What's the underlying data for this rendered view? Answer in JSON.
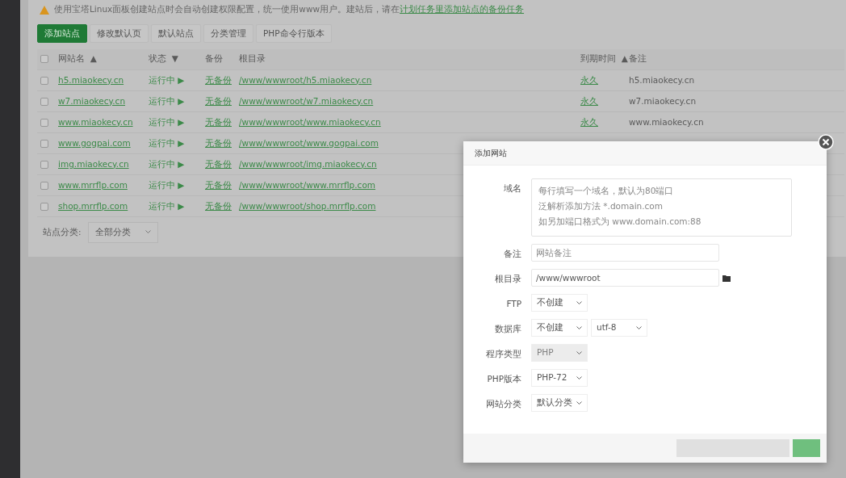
{
  "notice": {
    "text": "使用宝塔Linux面板创建站点时会自动创建权限配置，统一使用www用户。建站后，请在",
    "link": "计划任务里添加站点的备份任务"
  },
  "toolbar": [
    {
      "label": "添加站点",
      "kind": "primary"
    },
    {
      "label": "修改默认页",
      "kind": "plain"
    },
    {
      "label": "默认站点",
      "kind": "plain"
    },
    {
      "label": "分类管理",
      "kind": "plain"
    },
    {
      "label": "PHP命令行版本",
      "kind": "plain"
    }
  ],
  "table": {
    "select_all": {
      "checked": false
    },
    "columns": [
      {
        "label": "网站名",
        "sort": "▲"
      },
      {
        "label": "状态",
        "sort": "▼"
      },
      {
        "label": "备份"
      },
      {
        "label": "根目录"
      },
      {
        "label": "到期时间",
        "sort": "▲"
      },
      {
        "label": "备注"
      }
    ],
    "rows": [
      {
        "checked": false,
        "name": "h5.miaokecy.cn",
        "status": "运行中",
        "status_icon": "▶",
        "backup": "无备份",
        "root": "/www/wwwroot/h5.miaokecy.cn",
        "expiry": "永久",
        "remark": "h5.miaokecy.cn"
      },
      {
        "checked": false,
        "name": "w7.miaokecy.cn",
        "status": "运行中",
        "status_icon": "▶",
        "backup": "无备份",
        "root": "/www/wwwroot/w7.miaokecy.cn",
        "expiry": "永久",
        "remark": "w7.miaokecy.cn"
      },
      {
        "checked": false,
        "name": "www.miaokecy.cn",
        "status": "运行中",
        "status_icon": "▶",
        "backup": "无备份",
        "root": "/www/wwwroot/www.miaokecy.cn",
        "expiry": "永久",
        "remark": "www.miaokecy.cn"
      },
      {
        "checked": false,
        "name": "www.gogpai.com",
        "status": "运行中",
        "status_icon": "▶",
        "backup": "无备份",
        "root": "/www/wwwroot/www.gogpai.com"
      },
      {
        "checked": false,
        "name": "img.miaokecy.cn",
        "status": "运行中",
        "status_icon": "▶",
        "backup": "无备份",
        "root": "/www/wwwroot/img.miaokecy.cn"
      },
      {
        "checked": false,
        "name": "www.mrrflp.com",
        "status": "运行中",
        "status_icon": "▶",
        "backup": "无备份",
        "root": "/www/wwwroot/www.mrrflp.com"
      },
      {
        "checked": false,
        "name": "shop.mrrflp.com",
        "status": "运行中",
        "status_icon": "▶",
        "backup": "无备份",
        "root": "/www/wwwroot/shop.mrrflp.com"
      }
    ]
  },
  "category_filter": {
    "label": "站点分类:",
    "value": "全部分类"
  },
  "dialog": {
    "title": "添加网站",
    "fields": [
      {
        "kind": "textarea",
        "label": "域名",
        "placeholder_lines": [
          "每行填写一个域名，默认为80端口",
          "泛解析添加方法 *.domain.com",
          "如另加端口格式为 www.domain.com:88"
        ]
      },
      {
        "kind": "text",
        "label": "备注",
        "placeholder": "网站备注"
      },
      {
        "kind": "path",
        "label": "根目录",
        "value": "/www/wwwroot"
      },
      {
        "kind": "select",
        "label": "FTP",
        "selects": [
          {
            "value": "不创建",
            "disabled": false
          }
        ]
      },
      {
        "kind": "select",
        "label": "数据库",
        "selects": [
          {
            "value": "不创建",
            "disabled": false
          },
          {
            "value": "utf-8",
            "disabled": false
          }
        ]
      },
      {
        "kind": "select",
        "label": "程序类型",
        "selects": [
          {
            "value": "PHP",
            "disabled": true
          }
        ]
      },
      {
        "kind": "select",
        "label": "PHP版本",
        "selects": [
          {
            "value": "PHP-72",
            "disabled": false
          }
        ]
      },
      {
        "kind": "select",
        "label": "网站分类",
        "selects": [
          {
            "value": "默认分类",
            "disabled": false
          }
        ]
      }
    ]
  }
}
